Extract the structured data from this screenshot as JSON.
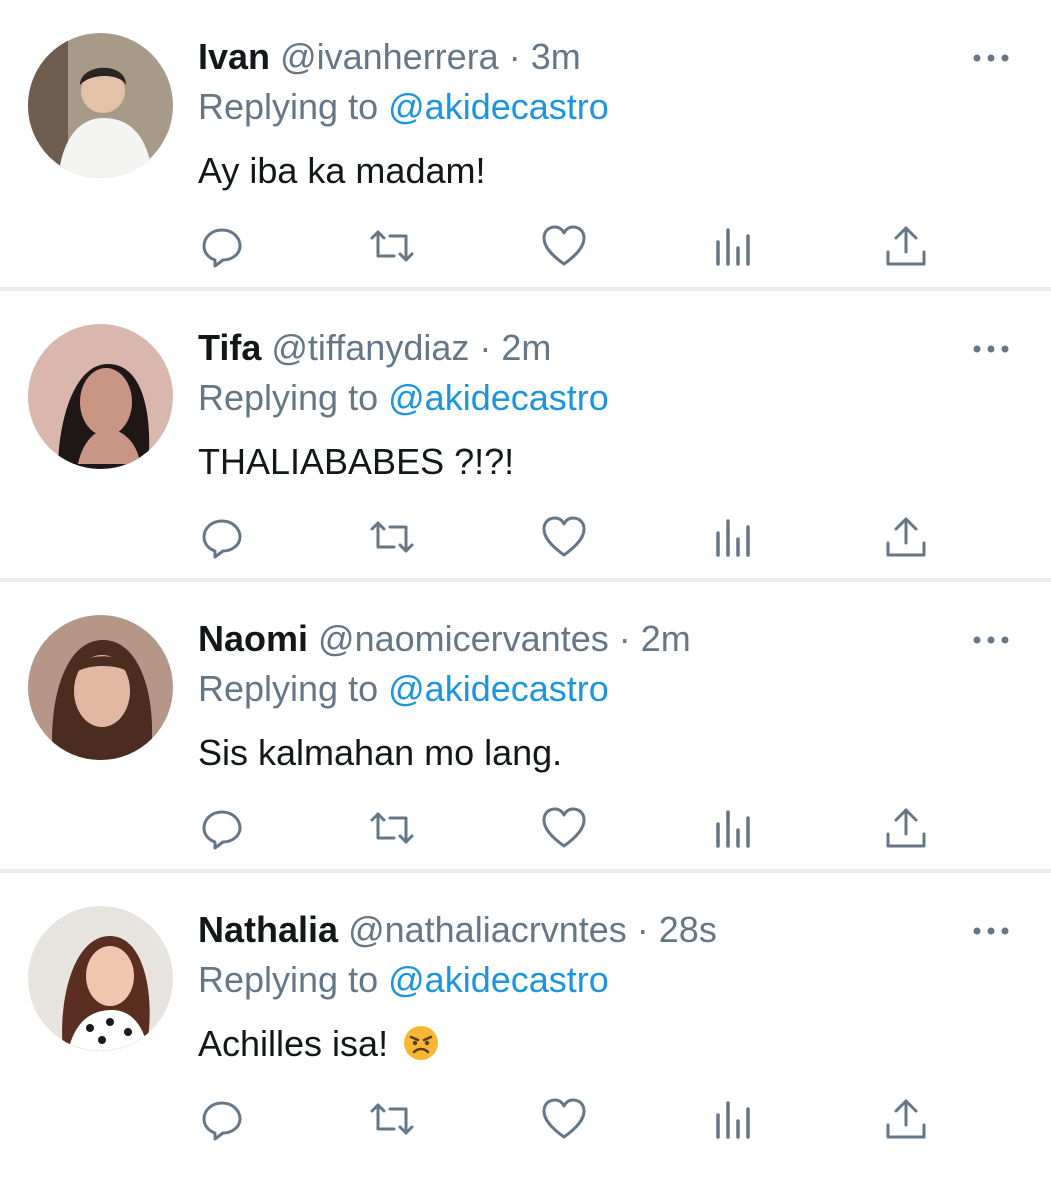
{
  "replies": [
    {
      "name": "Ivan",
      "handle": "@ivanherrera",
      "sep": "·",
      "time": "3m",
      "replying_prefix": "Replying to",
      "replying_to": "@akidecastro",
      "text": "Ay iba ka madam!",
      "avatar_colors": {
        "bg": "#a89a89",
        "accent": "#f4f4f2",
        "hair": "#2b2522"
      }
    },
    {
      "name": "Tifa",
      "handle": "@tiffanydiaz",
      "sep": "·",
      "time": "2m",
      "replying_prefix": "Replying to",
      "replying_to": "@akidecastro",
      "text": "THALIABABES ?!?!",
      "avatar_colors": {
        "bg": "#d9b7ac",
        "accent": "#c99584",
        "hair": "#1f1715"
      }
    },
    {
      "name": "Naomi",
      "handle": "@naomicervantes",
      "sep": "·",
      "time": "2m",
      "replying_prefix": "Replying to",
      "replying_to": "@akidecastro",
      "text": "Sis kalmahan mo lang.",
      "avatar_colors": {
        "bg": "#b59787",
        "accent": "#e2b8a2",
        "hair": "#4a2d20"
      }
    },
    {
      "name": "Nathalia",
      "handle": "@nathaliacrvntes",
      "sep": "·",
      "time": "28s",
      "replying_prefix": "Replying to",
      "replying_to": "@akidecastro",
      "text": "Achilles isa!",
      "emoji": "angry-face",
      "avatar_colors": {
        "bg": "#e7e3de",
        "accent": "#f0c6b0",
        "hair": "#5a2e20"
      }
    }
  ],
  "icons": {
    "reply": "reply-icon",
    "retweet": "retweet-icon",
    "like": "heart-icon",
    "analytics": "analytics-icon",
    "share": "share-icon",
    "more": "more-icon"
  },
  "colors": {
    "text_primary": "#14171a",
    "text_secondary": "#657786",
    "mention": "#1b95e0",
    "divider": "#e6ecf0",
    "icon": "#657786"
  }
}
